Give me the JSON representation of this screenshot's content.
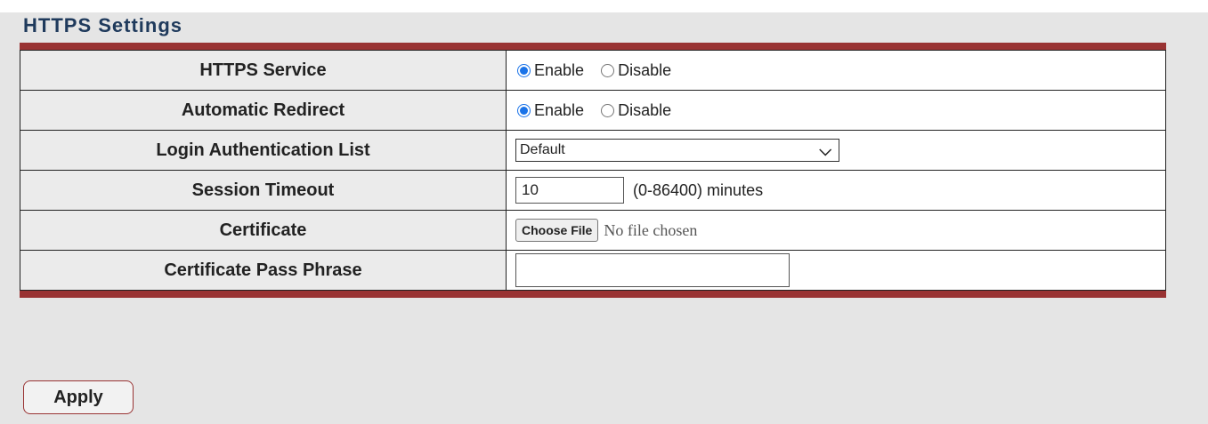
{
  "section_title": "HTTPS Settings",
  "rows": {
    "https_service": {
      "label": "HTTPS Service",
      "options": [
        "Enable",
        "Disable"
      ],
      "selected": "Enable"
    },
    "automatic_redirect": {
      "label": "Automatic Redirect",
      "options": [
        "Enable",
        "Disable"
      ],
      "selected": "Enable"
    },
    "login_auth_list": {
      "label": "Login Authentication List",
      "value": "Default"
    },
    "session_timeout": {
      "label": "Session Timeout",
      "value": "10",
      "suffix": "(0-86400) minutes"
    },
    "certificate": {
      "label": "Certificate",
      "button_label": "Choose File",
      "status": "No file chosen"
    },
    "pass_phrase": {
      "label": "Certificate Pass Phrase",
      "value": ""
    }
  },
  "apply_label": "Apply",
  "colors": {
    "accent_bar": "#993333",
    "title": "#1f3a5c",
    "radio_selected": "#1a73e8"
  }
}
